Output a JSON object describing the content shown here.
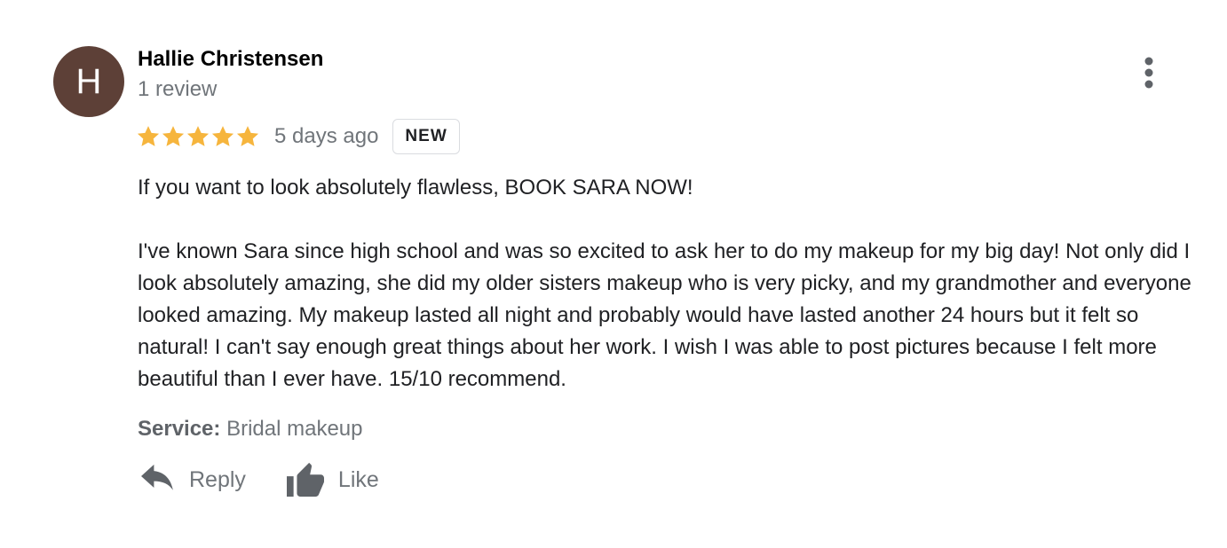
{
  "review": {
    "avatar_initial": "H",
    "avatar_color": "#5d4037",
    "author_name": "Hallie Christensen",
    "review_count": "1 review",
    "rating": 5,
    "rating_max": 5,
    "star_color": "#f6b53d",
    "date": "5 days ago",
    "badge": "NEW",
    "paragraphs": [
      "If you want to look absolutely flawless, BOOK SARA NOW!",
      "I've known Sara since high school and was so excited to ask her to do my makeup for my big day! Not only did I look absolutely amazing, she did my older sisters makeup who is very picky, and my grandmother and everyone looked amazing. My makeup lasted all night and probably would have lasted another 24 hours but it felt so natural! I can't say enough great things about her work. I wish I was able to post pictures because I felt more beautiful than I ever have. 15/10 recommend."
    ],
    "service_label": "Service:",
    "service_value": "Bridal makeup",
    "actions": {
      "reply_label": "Reply",
      "reply_icon": "reply-icon",
      "like_label": "Like",
      "like_icon": "thumbs-up-icon"
    },
    "more_icon": "more-vert-icon"
  }
}
